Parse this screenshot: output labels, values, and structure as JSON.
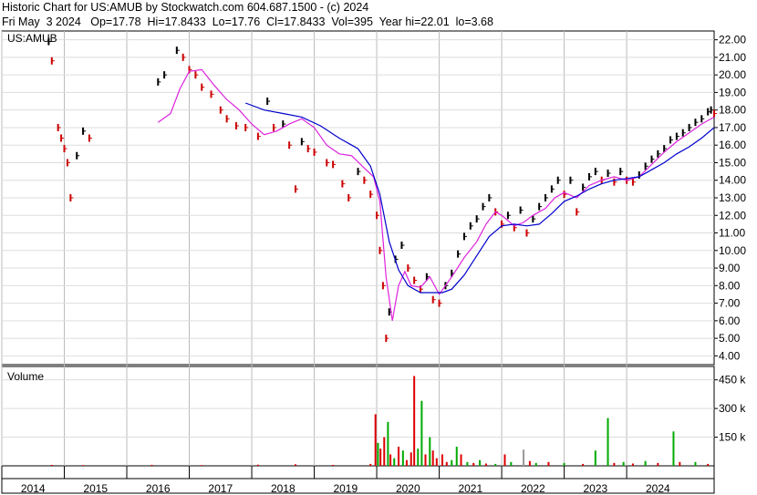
{
  "header": {
    "line1": "Historic Chart for US:AMUB by Stockwatch.com 604.687.1500 - (c) 2024",
    "line2": "Fri May  3 2024   Op=17.78  Hi=17.8433  Lo=17.76  Cl=17.8433  Vol=395  Year hi=22.01  lo=3.68"
  },
  "colors": {
    "price_up": "#000000",
    "price_down": "#cc0000",
    "ma_short": "#dd22dd",
    "ma_long": "#0000cc",
    "vol_up": "#00aa00",
    "vol_down": "#dd0000",
    "vol_neutral": "#999999"
  },
  "chart_data": [
    {
      "type": "line",
      "panel": "price",
      "label": "US:AMUB",
      "ylim": [
        3.5,
        22.5
      ],
      "yticks": [
        "22.00",
        "21.00",
        "20.00",
        "19.00",
        "18.00",
        "17.00",
        "16.00",
        "15.00",
        "14.00",
        "13.00",
        "12.00",
        "11.00",
        "10.00",
        "9.00",
        "8.00",
        "7.00",
        "6.00",
        "5.00",
        "4.00"
      ],
      "x_labels": [
        "2014",
        "2015",
        "2016",
        "2017",
        "2018",
        "2019",
        "2020",
        "2021",
        "2022",
        "2023",
        "2024"
      ],
      "series": [
        {
          "style": "price",
          "values": [
            [
              2014.75,
              21.9
            ],
            [
              2014.8,
              20.8
            ],
            [
              2014.9,
              17.0
            ],
            [
              2014.95,
              16.4
            ],
            [
              2015.0,
              15.8
            ],
            [
              2015.05,
              15.0
            ],
            [
              2015.1,
              13.0
            ],
            [
              2015.2,
              15.4
            ],
            [
              2015.3,
              16.8
            ],
            [
              2015.4,
              16.4
            ],
            [
              2016.5,
              19.6
            ],
            [
              2016.6,
              20.0
            ],
            [
              2016.8,
              21.4
            ],
            [
              2016.9,
              21.0
            ],
            [
              2017.0,
              20.3
            ],
            [
              2017.1,
              20.0
            ],
            [
              2017.2,
              19.3
            ],
            [
              2017.35,
              18.9
            ],
            [
              2017.5,
              18.0
            ],
            [
              2017.6,
              17.5
            ],
            [
              2017.75,
              17.1
            ],
            [
              2017.9,
              17.0
            ],
            [
              2018.1,
              16.5
            ],
            [
              2018.25,
              18.5
            ],
            [
              2018.35,
              17.0
            ],
            [
              2018.5,
              17.2
            ],
            [
              2018.6,
              16.0
            ],
            [
              2018.7,
              13.5
            ],
            [
              2018.8,
              16.2
            ],
            [
              2018.9,
              15.8
            ],
            [
              2019.0,
              15.6
            ],
            [
              2019.2,
              15.0
            ],
            [
              2019.3,
              14.9
            ],
            [
              2019.45,
              13.8
            ],
            [
              2019.55,
              13.0
            ],
            [
              2019.7,
              14.5
            ],
            [
              2019.8,
              14.0
            ],
            [
              2019.9,
              13.2
            ],
            [
              2020.0,
              12.0
            ],
            [
              2020.05,
              10.0
            ],
            [
              2020.1,
              8.0
            ],
            [
              2020.15,
              5.0
            ],
            [
              2020.2,
              6.5
            ],
            [
              2020.3,
              9.5
            ],
            [
              2020.4,
              10.3
            ],
            [
              2020.5,
              9.0
            ],
            [
              2020.6,
              8.3
            ],
            [
              2020.7,
              7.8
            ],
            [
              2020.8,
              8.5
            ],
            [
              2020.9,
              7.2
            ],
            [
              2021.0,
              7.0
            ],
            [
              2021.1,
              8.0
            ],
            [
              2021.2,
              8.7
            ],
            [
              2021.3,
              9.8
            ],
            [
              2021.4,
              10.8
            ],
            [
              2021.5,
              11.4
            ],
            [
              2021.6,
              11.8
            ],
            [
              2021.7,
              12.5
            ],
            [
              2021.8,
              13.0
            ],
            [
              2021.9,
              12.2
            ],
            [
              2022.0,
              11.5
            ],
            [
              2022.1,
              12.0
            ],
            [
              2022.2,
              11.3
            ],
            [
              2022.3,
              12.3
            ],
            [
              2022.4,
              11.0
            ],
            [
              2022.5,
              11.8
            ],
            [
              2022.6,
              12.5
            ],
            [
              2022.7,
              13.0
            ],
            [
              2022.8,
              13.5
            ],
            [
              2022.9,
              14.0
            ],
            [
              2023.0,
              13.2
            ],
            [
              2023.1,
              14.0
            ],
            [
              2023.2,
              12.2
            ],
            [
              2023.3,
              13.6
            ],
            [
              2023.4,
              14.2
            ],
            [
              2023.5,
              14.5
            ],
            [
              2023.6,
              14.0
            ],
            [
              2023.7,
              14.4
            ],
            [
              2023.8,
              13.9
            ],
            [
              2023.9,
              14.5
            ],
            [
              2024.0,
              14.0
            ],
            [
              2024.1,
              13.9
            ],
            [
              2024.2,
              14.3
            ],
            [
              2024.3,
              14.8
            ],
            [
              2024.4,
              15.2
            ],
            [
              2024.5,
              15.5
            ],
            [
              2024.6,
              15.8
            ],
            [
              2024.7,
              16.3
            ],
            [
              2024.8,
              16.5
            ],
            [
              2024.9,
              16.7
            ],
            [
              2025.0,
              17.0
            ],
            [
              2025.1,
              17.3
            ],
            [
              2025.2,
              17.5
            ],
            [
              2025.3,
              17.9
            ],
            [
              2025.35,
              18.0
            ],
            [
              2025.4,
              17.8
            ]
          ]
        },
        {
          "style": "ma_short",
          "values": [
            [
              2016.5,
              17.3
            ],
            [
              2016.7,
              17.8
            ],
            [
              2016.85,
              19.2
            ],
            [
              2017.0,
              20.2
            ],
            [
              2017.2,
              20.3
            ],
            [
              2017.4,
              19.4
            ],
            [
              2017.6,
              18.6
            ],
            [
              2017.8,
              18.0
            ],
            [
              2018.0,
              17.2
            ],
            [
              2018.2,
              16.6
            ],
            [
              2018.4,
              16.8
            ],
            [
              2018.6,
              17.2
            ],
            [
              2018.8,
              17.5
            ],
            [
              2019.0,
              17.0
            ],
            [
              2019.2,
              16.0
            ],
            [
              2019.4,
              15.5
            ],
            [
              2019.6,
              15.4
            ],
            [
              2019.8,
              14.7
            ],
            [
              2019.95,
              14.2
            ],
            [
              2020.05,
              12.8
            ],
            [
              2020.15,
              8.5
            ],
            [
              2020.25,
              6.0
            ],
            [
              2020.35,
              8.0
            ],
            [
              2020.45,
              8.8
            ],
            [
              2020.55,
              8.0
            ],
            [
              2020.7,
              7.9
            ],
            [
              2020.85,
              8.5
            ],
            [
              2021.0,
              7.5
            ],
            [
              2021.2,
              8.5
            ],
            [
              2021.4,
              9.6
            ],
            [
              2021.6,
              10.5
            ],
            [
              2021.75,
              11.5
            ],
            [
              2021.9,
              12.2
            ],
            [
              2022.0,
              12.0
            ],
            [
              2022.2,
              11.4
            ],
            [
              2022.35,
              11.6
            ],
            [
              2022.5,
              12.0
            ],
            [
              2022.7,
              12.4
            ],
            [
              2022.85,
              13.0
            ],
            [
              2023.0,
              13.3
            ],
            [
              2023.2,
              13.0
            ],
            [
              2023.4,
              13.7
            ],
            [
              2023.6,
              14.0
            ],
            [
              2023.8,
              14.2
            ],
            [
              2024.0,
              14.0
            ],
            [
              2024.2,
              14.2
            ],
            [
              2024.4,
              14.9
            ],
            [
              2024.6,
              15.6
            ],
            [
              2024.8,
              16.2
            ],
            [
              2025.0,
              16.7
            ],
            [
              2025.2,
              17.2
            ],
            [
              2025.4,
              17.6
            ]
          ]
        },
        {
          "style": "ma_long",
          "values": [
            [
              2017.9,
              18.4
            ],
            [
              2018.2,
              18.0
            ],
            [
              2018.5,
              17.8
            ],
            [
              2018.8,
              17.6
            ],
            [
              2019.1,
              17.1
            ],
            [
              2019.4,
              16.4
            ],
            [
              2019.7,
              15.8
            ],
            [
              2019.9,
              14.8
            ],
            [
              2020.05,
              13.2
            ],
            [
              2020.2,
              10.5
            ],
            [
              2020.35,
              8.9
            ],
            [
              2020.5,
              8.0
            ],
            [
              2020.7,
              7.6
            ],
            [
              2020.9,
              7.6
            ],
            [
              2021.05,
              7.6
            ],
            [
              2021.2,
              7.8
            ],
            [
              2021.4,
              8.6
            ],
            [
              2021.6,
              9.7
            ],
            [
              2021.8,
              10.8
            ],
            [
              2022.0,
              11.4
            ],
            [
              2022.2,
              11.5
            ],
            [
              2022.4,
              11.4
            ],
            [
              2022.6,
              11.5
            ],
            [
              2022.8,
              12.1
            ],
            [
              2023.0,
              12.8
            ],
            [
              2023.2,
              13.1
            ],
            [
              2023.4,
              13.5
            ],
            [
              2023.6,
              13.8
            ],
            [
              2023.8,
              14.0
            ],
            [
              2024.0,
              14.1
            ],
            [
              2024.2,
              14.2
            ],
            [
              2024.4,
              14.6
            ],
            [
              2024.6,
              15.0
            ],
            [
              2024.8,
              15.5
            ],
            [
              2025.0,
              15.9
            ],
            [
              2025.2,
              16.4
            ],
            [
              2025.4,
              17.0
            ]
          ]
        }
      ]
    },
    {
      "type": "bar",
      "panel": "volume",
      "label": "Volume",
      "ylim": [
        0,
        520
      ],
      "yticks": [
        "450 k",
        "300 k",
        "150 k"
      ],
      "ytick_values": [
        450,
        300,
        150
      ],
      "bars": [
        [
          2014.8,
          5,
          "down"
        ],
        [
          2015.3,
          4,
          "down"
        ],
        [
          2016.4,
          5,
          "down"
        ],
        [
          2017.2,
          4,
          "down"
        ],
        [
          2018.1,
          6,
          "down"
        ],
        [
          2018.7,
          8,
          "down"
        ],
        [
          2019.3,
          5,
          "down"
        ],
        [
          2019.9,
          10,
          "down"
        ],
        [
          2019.98,
          270,
          "down"
        ],
        [
          2020.02,
          120,
          "up"
        ],
        [
          2020.06,
          90,
          "down"
        ],
        [
          2020.12,
          150,
          "down"
        ],
        [
          2020.18,
          230,
          "up"
        ],
        [
          2020.22,
          60,
          "down"
        ],
        [
          2020.28,
          40,
          "up"
        ],
        [
          2020.35,
          100,
          "down"
        ],
        [
          2020.42,
          80,
          "up"
        ],
        [
          2020.48,
          30,
          "down"
        ],
        [
          2020.55,
          70,
          "down"
        ],
        [
          2020.6,
          470,
          "down"
        ],
        [
          2020.66,
          90,
          "up"
        ],
        [
          2020.72,
          340,
          "up"
        ],
        [
          2020.78,
          60,
          "down"
        ],
        [
          2020.85,
          150,
          "up"
        ],
        [
          2020.9,
          80,
          "down"
        ],
        [
          2020.96,
          40,
          "down"
        ],
        [
          2021.05,
          60,
          "down"
        ],
        [
          2021.12,
          20,
          "down"
        ],
        [
          2021.2,
          30,
          "up"
        ],
        [
          2021.28,
          100,
          "up"
        ],
        [
          2021.35,
          60,
          "down"
        ],
        [
          2021.45,
          20,
          "up"
        ],
        [
          2021.55,
          15,
          "down"
        ],
        [
          2021.65,
          30,
          "up"
        ],
        [
          2021.75,
          12,
          "down"
        ],
        [
          2021.9,
          10,
          "up"
        ],
        [
          2022.05,
          60,
          "down"
        ],
        [
          2022.15,
          20,
          "up"
        ],
        [
          2022.35,
          85,
          "neutral"
        ],
        [
          2022.45,
          25,
          "down"
        ],
        [
          2022.55,
          15,
          "up"
        ],
        [
          2022.75,
          20,
          "down"
        ],
        [
          2023.0,
          15,
          "up"
        ],
        [
          2023.3,
          10,
          "down"
        ],
        [
          2023.5,
          80,
          "up"
        ],
        [
          2023.7,
          250,
          "up"
        ],
        [
          2023.8,
          15,
          "down"
        ],
        [
          2023.95,
          20,
          "up"
        ],
        [
          2024.1,
          12,
          "down"
        ],
        [
          2024.3,
          25,
          "up"
        ],
        [
          2024.5,
          15,
          "down"
        ],
        [
          2024.75,
          180,
          "up"
        ],
        [
          2024.85,
          20,
          "down"
        ],
        [
          2025.1,
          20,
          "up"
        ],
        [
          2025.3,
          10,
          "down"
        ]
      ]
    }
  ]
}
